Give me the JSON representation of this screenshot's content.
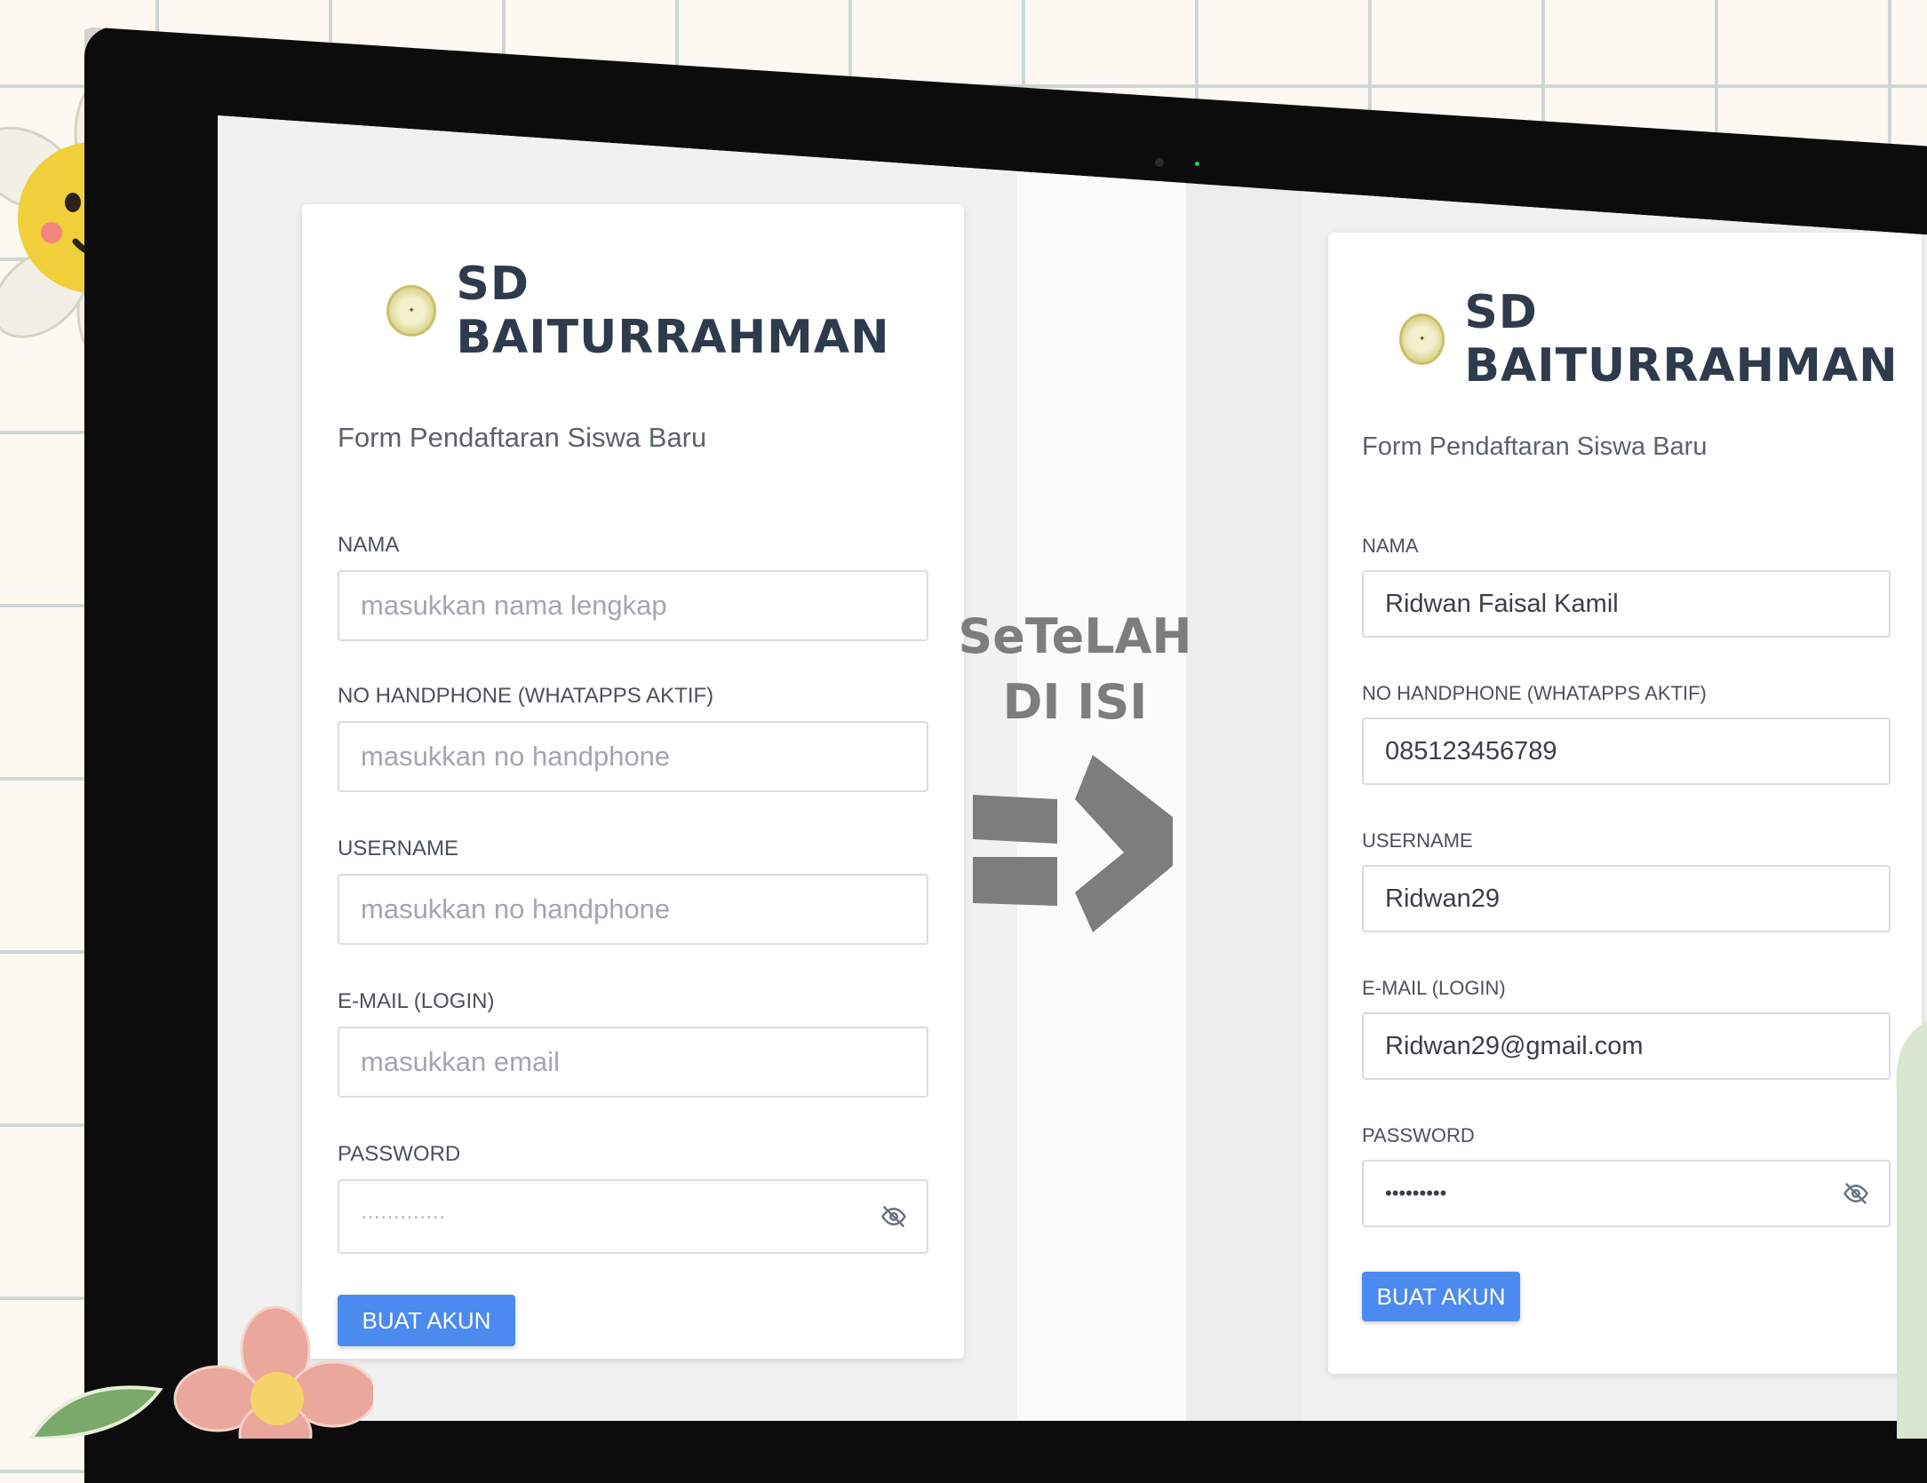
{
  "left_form": {
    "school_name": "SD BAITURRAHMAN",
    "subtitle": "Form Pendaftaran Siswa Baru",
    "fields": [
      {
        "label": "NAMA",
        "placeholder": "masukkan nama lengkap",
        "value": ""
      },
      {
        "label": "NO HANDPHONE (WHATAPPS AKTIF)",
        "placeholder": "masukkan no handphone",
        "value": ""
      },
      {
        "label": "USERNAME",
        "placeholder": "masukkan no handphone",
        "value": ""
      },
      {
        "label": "E-MAIL (LOGIN)",
        "placeholder": "masukkan email",
        "value": ""
      },
      {
        "label": "PASSWORD",
        "value": "·············"
      }
    ],
    "button": "BUAT AKUN"
  },
  "right_form": {
    "school_name": "SD BAITURRAHMAN",
    "subtitle": "Form Pendaftaran Siswa Baru",
    "fields": [
      {
        "label": "NAMA",
        "value": "Ridwan Faisal Kamil"
      },
      {
        "label": "NO HANDPHONE (WHATAPPS AKTIF)",
        "value": "085123456789"
      },
      {
        "label": "USERNAME",
        "value": "Ridwan29"
      },
      {
        "label": "E-MAIL (LOGIN)",
        "value": "Ridwan29@gmail.com"
      },
      {
        "label": "PASSWORD",
        "value": "•••••••••"
      }
    ],
    "button": "BUAT AKUN"
  },
  "caption": {
    "line1": "SeTeLAH",
    "line2": "DI ISI"
  },
  "icons": {
    "logo": "school-logo-icon",
    "eye": "eye-slash-icon",
    "arrow": "right-arrow-icon"
  },
  "colors": {
    "button": "#4c8af0",
    "brand_text": "#2f3a4c",
    "background": "#fdf8f2",
    "grid": "#cfd6d6"
  }
}
